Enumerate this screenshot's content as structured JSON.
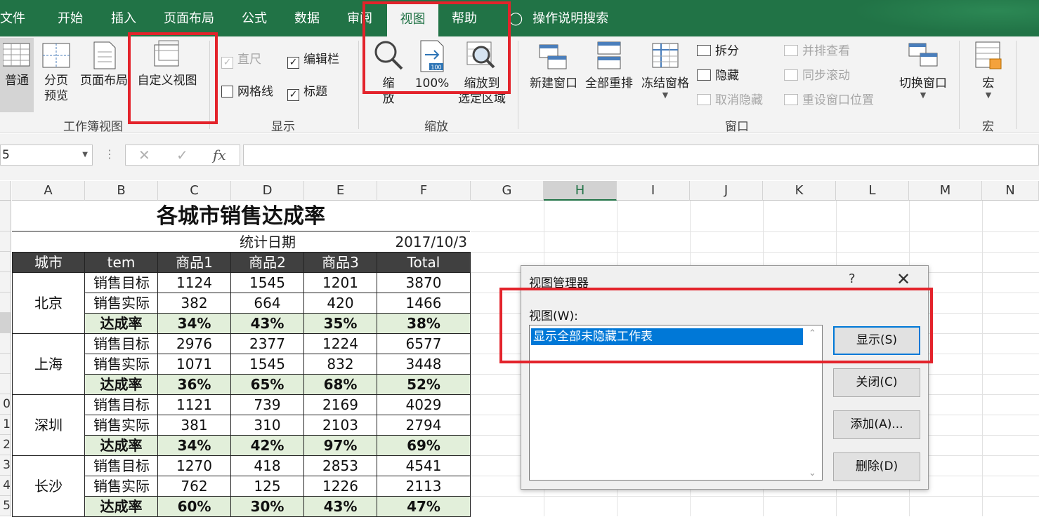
{
  "tabs": [
    "文件",
    "开始",
    "插入",
    "页面布局",
    "公式",
    "数据",
    "审阅",
    "视图",
    "帮助"
  ],
  "active_tab": "视图",
  "tell_me": "操作说明搜索",
  "ribbon": {
    "workbook_views": {
      "normal": "普通",
      "page_break_1": "分页",
      "page_break_2": "预览",
      "page_layout": "页面布局",
      "custom_views": "自定义视图",
      "label": "工作簿视图"
    },
    "show": {
      "ruler": "直尺",
      "formula_bar": "编辑栏",
      "gridlines": "网格线",
      "headings": "标题",
      "label": "显示"
    },
    "zoom": {
      "zoom_1": "缩",
      "zoom_2": "放",
      "zoom100": "100%",
      "zoom100_icon_text": "100",
      "zoom_sel_1": "缩放到",
      "zoom_sel_2": "选定区域",
      "label": "缩放"
    },
    "window": {
      "new_window": "新建窗口",
      "arrange_all": "全部重排",
      "freeze_panes": "冻结窗格",
      "split": "拆分",
      "hide": "隐藏",
      "unhide": "取消隐藏",
      "side_by_side": "并排查看",
      "sync_scroll": "同步滚动",
      "reset_position": "重设窗口位置",
      "switch_windows": "切换窗口",
      "label": "窗口"
    },
    "macros": {
      "macros": "宏",
      "label": "宏"
    }
  },
  "formula_bar": {
    "name_box": "5",
    "fx": "fx",
    "cancel": "✕",
    "enter": "✓",
    "value": ""
  },
  "columns": [
    "A",
    "B",
    "C",
    "D",
    "E",
    "F",
    "G",
    "H",
    "I",
    "J",
    "K",
    "L",
    "M",
    "N"
  ],
  "selected_column": "H",
  "row_numbers": [
    "",
    "",
    "",
    "",
    "",
    "",
    "",
    "",
    "",
    "0",
    "1",
    "2",
    "3",
    "4",
    "5"
  ],
  "sheet": {
    "title": "各城市销售达成率",
    "date_label": "统计日期",
    "date_value": "2017/10/3",
    "headers": [
      "城市",
      "tem",
      "商品1",
      "商品2",
      "商品3",
      "Total"
    ],
    "groups": [
      {
        "city": "北京",
        "rows": [
          [
            "销售目标",
            "1124",
            "1545",
            "1201",
            "3870"
          ],
          [
            "销售实际",
            "382",
            "664",
            "420",
            "1466"
          ],
          [
            "达成率",
            "34%",
            "43%",
            "35%",
            "38%"
          ]
        ]
      },
      {
        "city": "上海",
        "rows": [
          [
            "销售目标",
            "2976",
            "2377",
            "1224",
            "6577"
          ],
          [
            "销售实际",
            "1071",
            "1545",
            "832",
            "3448"
          ],
          [
            "达成率",
            "36%",
            "65%",
            "68%",
            "52%"
          ]
        ]
      },
      {
        "city": "深圳",
        "rows": [
          [
            "销售目标",
            "1121",
            "739",
            "2169",
            "4029"
          ],
          [
            "销售实际",
            "381",
            "310",
            "2103",
            "2794"
          ],
          [
            "达成率",
            "34%",
            "42%",
            "97%",
            "69%"
          ]
        ]
      },
      {
        "city": "长沙",
        "rows": [
          [
            "销售目标",
            "1270",
            "418",
            "2853",
            "4541"
          ],
          [
            "销售实际",
            "762",
            "125",
            "1226",
            "2113"
          ],
          [
            "达成率",
            "60%",
            "30%",
            "43%",
            "47%"
          ]
        ]
      }
    ]
  },
  "dialog": {
    "title": "视图管理器",
    "help": "?",
    "views_label": "视图(W):",
    "views": [
      "显示全部未隐藏工作表"
    ],
    "buttons": {
      "show": "显示(S)",
      "close": "关闭(C)",
      "add": "添加(A)...",
      "delete": "删除(D)"
    }
  },
  "colors": {
    "excel_green": "#217346",
    "header_dark": "#404040",
    "rate_fill": "#e2efda",
    "highlight_red": "#e3232b",
    "selection_blue": "#0078d7"
  }
}
